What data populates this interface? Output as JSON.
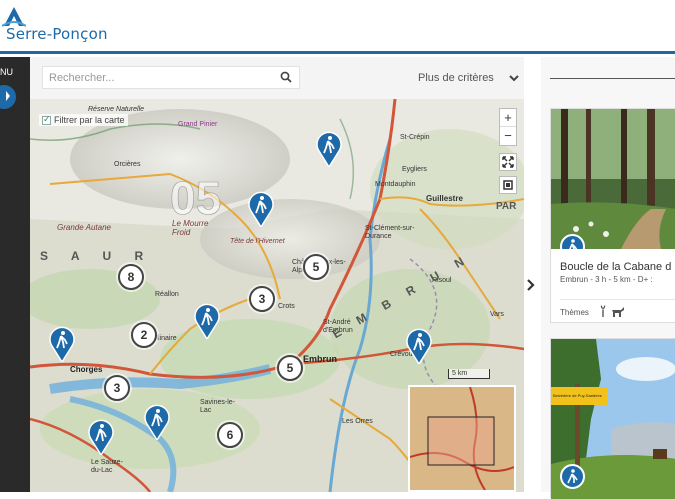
{
  "header": {
    "logo_text": "Serre-Ponçon"
  },
  "leftbar": {
    "menu_label": "NU"
  },
  "search": {
    "placeholder": "Rechercher...",
    "more_criteria": "Plus de critères"
  },
  "map": {
    "filter_label": "Filtrer par la carte",
    "zoom_in": "+",
    "zoom_out": "−",
    "scale_label": "5 km",
    "clusters": [
      "8",
      "5",
      "3",
      "2",
      "5",
      "3",
      "6"
    ],
    "place_labels": [
      "Réserve Naturelle",
      "Grand Pinier",
      "Orcières",
      "Grande Autane",
      "Le Mourre Froid",
      "Tête de l'Hivernet",
      "Châteauroux-les-Alpes",
      "St-Clément-sur-Durance",
      "Guillestre",
      "Eygliers",
      "Réallon",
      "Chorges",
      "Savines-le-Lac",
      "St-Apollinaire",
      "Embrun",
      "Crévoux",
      "Les Orres",
      "Le Sauze-du-Lac",
      "Crots",
      "St-André d'Embrun",
      "Vars",
      "Risoul",
      "St-Crépin",
      "Montdauphin"
    ],
    "area_labels": [
      "S A U R",
      "E M B R U N",
      "05",
      "PAR"
    ]
  },
  "results": {
    "cards": [
      {
        "title": "Boucle de la Cabane d",
        "meta": "Embrun - 3 h - 5 km - D+ :",
        "themes_label": "Thèmes"
      },
      {
        "sign_text": "Belvédère de Puy-Sanières"
      }
    ]
  },
  "colors": {
    "brand": "#1e6aa8",
    "pin": "#1e6aa8",
    "road": "#d2563a",
    "secondary_road": "#e6a93a"
  }
}
